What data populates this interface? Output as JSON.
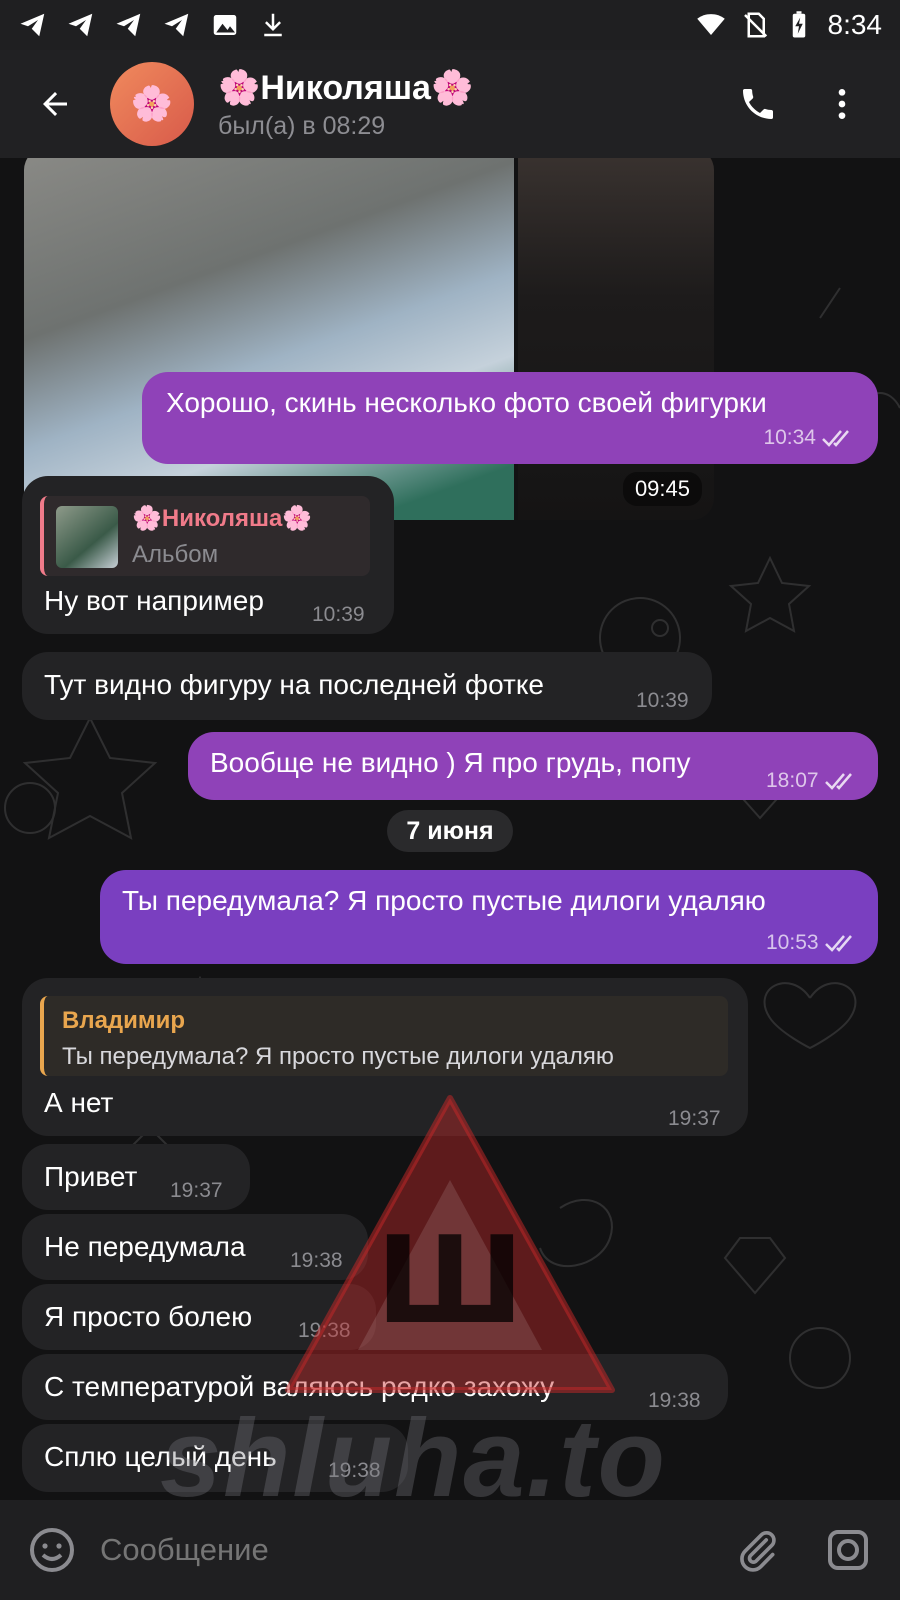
{
  "status_bar": {
    "time": "8:34"
  },
  "header": {
    "title": "🌸Николяша🌸",
    "status": "был(а) в 08:29",
    "avatar_emoji": "🌸"
  },
  "album": {
    "time": "09:45"
  },
  "messages": [
    {
      "direction": "out",
      "text": "Хорошо, скинь несколько фото своей фигурки",
      "time": "10:34"
    },
    {
      "direction": "in",
      "reply_name": "🌸Николяша🌸",
      "reply_text": "Альбом",
      "text": "Ну вот например",
      "time": "10:39"
    },
    {
      "direction": "in",
      "text": "Тут видно фигуру  на последней фотке",
      "time": "10:39"
    },
    {
      "direction": "out",
      "text": "Вообще не видно ) Я про грудь, попу",
      "time": "18:07"
    },
    {
      "direction": "out",
      "text": "Ты передумала? Я просто пустые дилоги удаляю",
      "time": "10:53"
    },
    {
      "direction": "in",
      "reply_name": "Владимир",
      "reply_text": "Ты передумала? Я просто пустые дилоги удаляю",
      "text": "А нет",
      "time": "19:37"
    },
    {
      "direction": "in",
      "text": "Привет",
      "time": "19:37"
    },
    {
      "direction": "in",
      "text": "Не передумала",
      "time": "19:38"
    },
    {
      "direction": "in",
      "text": "Я просто болею",
      "time": "19:38"
    },
    {
      "direction": "in",
      "text": "С температурой валяюсь редко захожу",
      "time": "19:38"
    },
    {
      "direction": "in",
      "text": "Сплю целый день",
      "time": "19:38"
    }
  ],
  "date_separator": "7 июня",
  "watermark": "shluha.to",
  "watermark_letter": "Ш",
  "input": {
    "placeholder": "Сообщение"
  },
  "colors": {
    "outgoing": "#7a3fc0",
    "incoming": "#232325",
    "reply_pink": "#f07b8a",
    "reply_orange": "#e9a64e"
  }
}
